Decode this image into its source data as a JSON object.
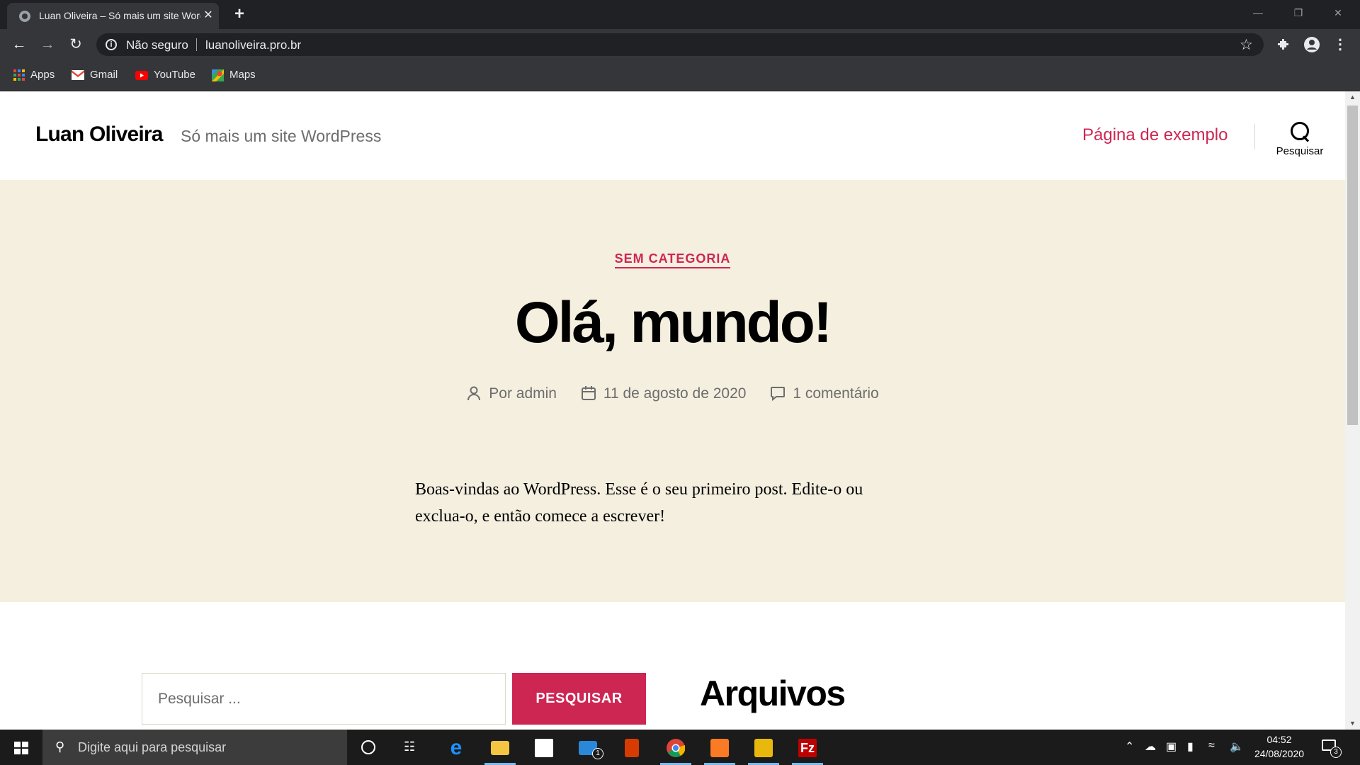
{
  "browser": {
    "tab_title": "Luan Oliveira – Só mais um site WordPress",
    "tab_close": "✕",
    "new_tab": "+",
    "security_label": "Não seguro",
    "url": "luanoliveira.pro.br",
    "bookmarks": [
      {
        "label": "Apps",
        "icon": "apps-grid-icon"
      },
      {
        "label": "Gmail",
        "icon": "gmail-icon"
      },
      {
        "label": "YouTube",
        "icon": "youtube-icon"
      },
      {
        "label": "Maps",
        "icon": "maps-icon"
      }
    ]
  },
  "site": {
    "title": "Luan Oliveira",
    "description": "Só mais um site WordPress",
    "nav_link": "Página de exemplo",
    "search_toggle_label": "Pesquisar",
    "accent_color": "#cd2653",
    "hero_background": "#f5efe0"
  },
  "post": {
    "category": "SEM CATEGORIA",
    "title": "Olá, mundo!",
    "author": "Por admin",
    "date": "11 de agosto de 2020",
    "comments": "1 comentário",
    "content": "Boas-vindas ao WordPress. Esse é o seu primeiro post. Edite-o ou exclua-o, e então comece a escrever!"
  },
  "widgets": {
    "search_placeholder": "Pesquisar ...",
    "search_button": "PESQUISAR",
    "archives_heading": "Arquivos"
  },
  "taskbar": {
    "search_placeholder": "Digite aqui para pesquisar",
    "mail_badge": "1",
    "time": "04:52",
    "date": "24/08/2020",
    "notifications_count": "3"
  }
}
